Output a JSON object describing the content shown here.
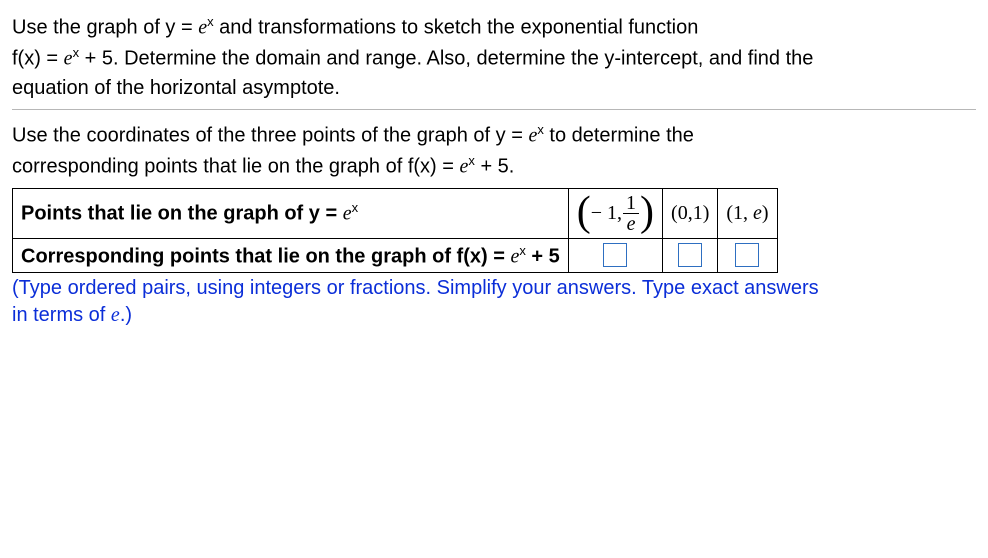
{
  "intro": {
    "line1_a": "Use the graph of y = ",
    "line1_b": " and transformations to sketch the exponential function",
    "line2_a": "f(x) = ",
    "line2_b": " + 5. Determine the domain and range. Also, determine the y-intercept, and find the",
    "line3": "equation of the horizontal asymptote."
  },
  "section": {
    "line1_a": "Use the coordinates of the three points of the graph of y = ",
    "line1_b": " to determine the",
    "line2_a": "corresponding points that lie on the graph of f(x) = ",
    "line2_b": " + 5."
  },
  "table": {
    "row1_label_a": "Points that lie on the graph of y = ",
    "row2_label_a": "Corresponding points that lie on the graph of f(x) = ",
    "row2_label_b": " + 5",
    "p1_prefix": "− 1,",
    "frac_num": "1",
    "frac_den": "e",
    "p2": "(0,1)",
    "p3_a": "(1, ",
    "p3_b": ")"
  },
  "expr": {
    "e": "e",
    "x": "x"
  },
  "hint": {
    "line1": "(Type ordered pairs, using integers or fractions. Simplify your answers. Type exact answers",
    "line2_a": "in terms of ",
    "line2_b": ".)"
  }
}
